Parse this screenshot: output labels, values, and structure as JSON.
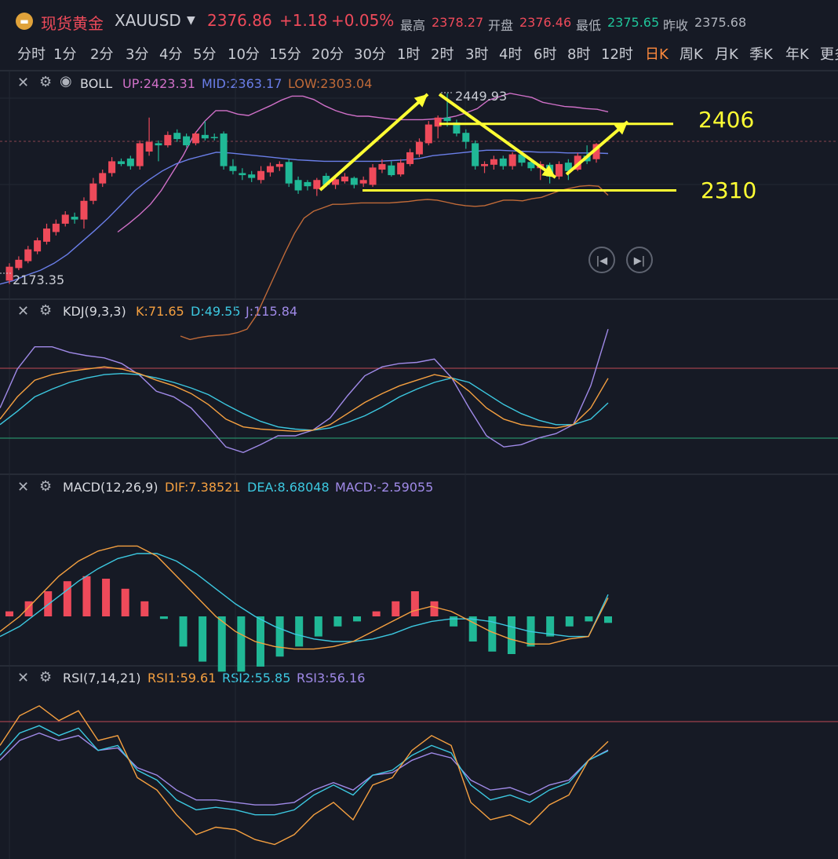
{
  "header": {
    "logo_icon": "gold-bar-icon",
    "symbol_name": "现货黄金",
    "symbol_code": "XAUUSD",
    "dropdown_icon": "caret-down-icon",
    "price": "2376.86",
    "change": "+1.18",
    "change_pct": "+0.05%",
    "high_label": "最高",
    "high_value": "2378.27",
    "open_label": "开盘",
    "open_value": "2376.46",
    "low_label": "最低",
    "low_value": "2375.65",
    "prev_label": "昨收",
    "prev_value": "2375.68"
  },
  "periods": [
    "分时",
    "1分",
    "2分",
    "3分",
    "4分",
    "5分",
    "10分",
    "15分",
    "20分",
    "30分",
    "1时",
    "2时",
    "3时",
    "4时",
    "6时",
    "8时",
    "12时",
    "日K",
    "周K",
    "月K",
    "季K",
    "年K",
    "更多"
  ],
  "active_period": "日K",
  "panels": {
    "boll": {
      "name": "BOLL",
      "up": "UP:2423.31",
      "mid": "MID:2363.17",
      "low": "LOW:2303.04"
    },
    "kdj": {
      "name": "KDJ(9,3,3)",
      "k": "K:71.65",
      "d": "D:49.55",
      "j": "J:115.84"
    },
    "macd": {
      "name": "MACD(12,26,9)",
      "dif": "DIF:7.38521",
      "dea": "DEA:8.68048",
      "macd": "MACD:-2.59055"
    },
    "rsi": {
      "name": "RSI(7,14,21)",
      "rsi1": "RSI1:59.61",
      "rsi2": "RSI2:55.85",
      "rsi3": "RSI3:56.16"
    }
  },
  "annotations": {
    "resistance": "2406",
    "support": "2310",
    "high_mark": "2449.93",
    "low_mark": "2173.35"
  },
  "colors": {
    "up": "#ee4a5a",
    "down": "#20b896",
    "boll_up": "#d070c8",
    "boll_mid": "#6a7ee8",
    "boll_low": "#c06a38",
    "k": "#f5a040",
    "d": "#3cc8e0",
    "j": "#a08ae8",
    "annotation": "#ffff33"
  },
  "chart_data": {
    "type": "candlestick",
    "candles": [
      [
        2200,
        2180,
        2205,
        2175
      ],
      [
        2210,
        2198,
        2215,
        2195
      ],
      [
        2225,
        2208,
        2230,
        2205
      ],
      [
        2238,
        2222,
        2242,
        2218
      ],
      [
        2255,
        2236,
        2262,
        2232
      ],
      [
        2262,
        2250,
        2268,
        2245
      ],
      [
        2275,
        2262,
        2280,
        2258
      ],
      [
        2268,
        2272,
        2278,
        2262
      ],
      [
        2295,
        2268,
        2300,
        2255
      ],
      [
        2320,
        2295,
        2328,
        2290
      ],
      [
        2335,
        2320,
        2340,
        2315
      ],
      [
        2352,
        2335,
        2358,
        2330
      ],
      [
        2348,
        2352,
        2356,
        2345
      ],
      [
        2345,
        2356,
        2360,
        2340
      ],
      [
        2378,
        2345,
        2382,
        2340
      ],
      [
        2380,
        2366,
        2415,
        2360
      ],
      [
        2375,
        2378,
        2382,
        2352
      ],
      [
        2390,
        2375,
        2395,
        2372
      ],
      [
        2384,
        2393,
        2398,
        2380
      ],
      [
        2375,
        2388,
        2392,
        2372
      ],
      [
        2392,
        2378,
        2395,
        2375
      ],
      [
        2385,
        2390,
        2410,
        2382
      ],
      [
        2386,
        2387,
        2392,
        2382
      ],
      [
        2345,
        2392,
        2395,
        2340
      ],
      [
        2338,
        2345,
        2355,
        2333
      ],
      [
        2332,
        2335,
        2342,
        2325
      ],
      [
        2328,
        2333,
        2338,
        2322
      ],
      [
        2338,
        2325,
        2345,
        2320
      ],
      [
        2345,
        2336,
        2350,
        2330
      ],
      [
        2348,
        2344,
        2352,
        2338
      ],
      [
        2320,
        2351,
        2355,
        2315
      ],
      [
        2310,
        2325,
        2330,
        2305
      ],
      [
        2316,
        2322,
        2325,
        2310
      ],
      [
        2325,
        2312,
        2328,
        2302
      ],
      [
        2318,
        2331,
        2335,
        2315
      ],
      [
        2326,
        2318,
        2330,
        2312
      ],
      [
        2330,
        2323,
        2335,
        2320
      ],
      [
        2318,
        2328,
        2330,
        2313
      ],
      [
        2325,
        2320,
        2330,
        2315
      ],
      [
        2343,
        2318,
        2348,
        2315
      ],
      [
        2348,
        2340,
        2355,
        2335
      ],
      [
        2332,
        2346,
        2352,
        2330
      ],
      [
        2350,
        2333,
        2355,
        2330
      ],
      [
        2365,
        2348,
        2370,
        2345
      ],
      [
        2380,
        2362,
        2385,
        2358
      ],
      [
        2405,
        2378,
        2410,
        2375
      ],
      [
        2415,
        2402,
        2418,
        2385
      ],
      [
        2410,
        2415,
        2449.93,
        2402
      ],
      [
        2392,
        2408,
        2412,
        2388
      ],
      [
        2380,
        2393,
        2398,
        2370
      ],
      [
        2345,
        2378,
        2382,
        2340
      ],
      [
        2348,
        2345,
        2352,
        2335
      ],
      [
        2355,
        2347,
        2360,
        2340
      ],
      [
        2345,
        2356,
        2360,
        2340
      ],
      [
        2362,
        2345,
        2365,
        2340
      ],
      [
        2350,
        2362,
        2366,
        2345
      ],
      [
        2342,
        2351,
        2355,
        2338
      ],
      [
        2348,
        2342,
        2352,
        2325
      ],
      [
        2330,
        2347,
        2350,
        2320
      ],
      [
        2348,
        2330,
        2352,
        2326
      ],
      [
        2338,
        2350,
        2355,
        2325
      ],
      [
        2360,
        2340,
        2364,
        2338
      ],
      [
        2352,
        2360,
        2375,
        2348
      ],
      [
        2376.86,
        2355,
        2378.27,
        2350
      ]
    ],
    "boll_up": [
      2250,
      2262,
      2275,
      2290,
      2310,
      2335,
      2360,
      2390,
      2410,
      2425,
      2425,
      2420,
      2418,
      2425,
      2432,
      2440,
      2446,
      2446,
      2441,
      2432,
      2425,
      2420,
      2417,
      2417,
      2415,
      2413,
      2412,
      2412,
      2412,
      2413,
      2414,
      2417,
      2422,
      2428,
      2440,
      2445,
      2450,
      2447,
      2444,
      2437,
      2434,
      2431,
      2430,
      2428,
      2427,
      2423.31
    ],
    "boll_mid": [
      2175,
      2180,
      2188,
      2195,
      2205,
      2218,
      2235,
      2252,
      2270,
      2290,
      2310,
      2325,
      2338,
      2348,
      2355,
      2360,
      2365,
      2364,
      2362,
      2360,
      2358,
      2356,
      2354,
      2353,
      2352,
      2352,
      2352,
      2352,
      2352,
      2353,
      2354,
      2356,
      2360,
      2362,
      2364,
      2366,
      2368,
      2368,
      2367,
      2366,
      2365,
      2365,
      2364,
      2364,
      2364,
      2363.17
    ],
    "boll_low": [
      2100,
      2095,
      2098,
      2100,
      2101,
      2102,
      2105,
      2110,
      2130,
      2160,
      2190,
      2220,
      2248,
      2270,
      2280,
      2285,
      2290,
      2290,
      2291,
      2292,
      2292,
      2292,
      2292,
      2293,
      2294,
      2296,
      2297,
      2296,
      2293,
      2290,
      2288,
      2287,
      2288,
      2292,
      2296,
      2296,
      2295,
      2298,
      2300,
      2305,
      2310,
      2313,
      2316,
      2317,
      2316,
      2303.04
    ],
    "kdj_k": [
      35,
      55,
      70,
      75,
      78,
      80,
      82,
      80,
      76,
      70,
      65,
      58,
      48,
      35,
      28,
      26,
      25,
      24,
      25,
      30,
      40,
      50,
      58,
      65,
      70,
      75,
      72,
      60,
      45,
      35,
      30,
      28,
      27,
      30,
      45,
      71.65
    ],
    "kdj_d": [
      30,
      42,
      55,
      62,
      68,
      72,
      75,
      76,
      75,
      72,
      68,
      63,
      57,
      48,
      40,
      33,
      28,
      26,
      25,
      27,
      32,
      38,
      46,
      55,
      62,
      68,
      72,
      68,
      58,
      48,
      40,
      34,
      30,
      30,
      35,
      49.55
    ],
    "kdj_j": [
      45,
      80,
      100,
      100,
      95,
      92,
      90,
      85,
      75,
      60,
      55,
      45,
      28,
      10,
      5,
      12,
      20,
      20,
      25,
      36,
      56,
      74,
      82,
      85,
      86,
      89,
      72,
      45,
      20,
      10,
      12,
      18,
      22,
      30,
      65,
      115.84
    ],
    "macd_dif": [
      -6,
      0,
      8,
      16,
      22,
      26,
      28,
      28,
      24,
      16,
      8,
      0,
      -6,
      -10,
      -12,
      -13,
      -13,
      -12,
      -10,
      -6,
      -2,
      2,
      4,
      2,
      -2,
      -6,
      -9,
      -11,
      -11,
      -9,
      -8,
      7.38521
    ],
    "macd_dea": [
      -8,
      -4,
      2,
      8,
      14,
      19,
      23,
      25,
      25,
      22,
      17,
      11,
      5,
      0,
      -4,
      -7,
      -9,
      -10,
      -10,
      -9,
      -7,
      -4,
      -2,
      -1,
      -1,
      -2,
      -4,
      -6,
      -7,
      -8,
      -8,
      8.68048
    ],
    "macd_hist": [
      2,
      6,
      10,
      14,
      16,
      15,
      11,
      6,
      -1,
      -12,
      -18,
      -22,
      -22,
      -20,
      -16,
      -12,
      -8,
      -4,
      -2,
      2,
      6,
      10,
      6,
      -4,
      -10,
      -14,
      -15,
      -12,
      -8,
      -4,
      -2,
      -2.59055
    ],
    "rsi1": [
      58,
      70,
      74,
      68,
      72,
      60,
      62,
      45,
      40,
      30,
      22,
      25,
      24,
      20,
      18,
      22,
      30,
      35,
      28,
      42,
      45,
      56,
      62,
      58,
      35,
      28,
      30,
      26,
      34,
      38,
      52,
      59.61
    ],
    "rsi2": [
      54,
      63,
      66,
      62,
      65,
      56,
      58,
      48,
      44,
      36,
      32,
      33,
      32,
      30,
      30,
      32,
      38,
      42,
      38,
      46,
      48,
      54,
      58,
      55,
      42,
      36,
      38,
      35,
      40,
      43,
      52,
      55.85
    ],
    "rsi3": [
      52,
      60,
      63,
      60,
      62,
      56,
      57,
      49,
      46,
      40,
      36,
      36,
      35,
      34,
      34,
      35,
      40,
      43,
      40,
      46,
      47,
      52,
      55,
      53,
      44,
      40,
      41,
      38,
      42,
      44,
      52,
      56.16
    ]
  }
}
